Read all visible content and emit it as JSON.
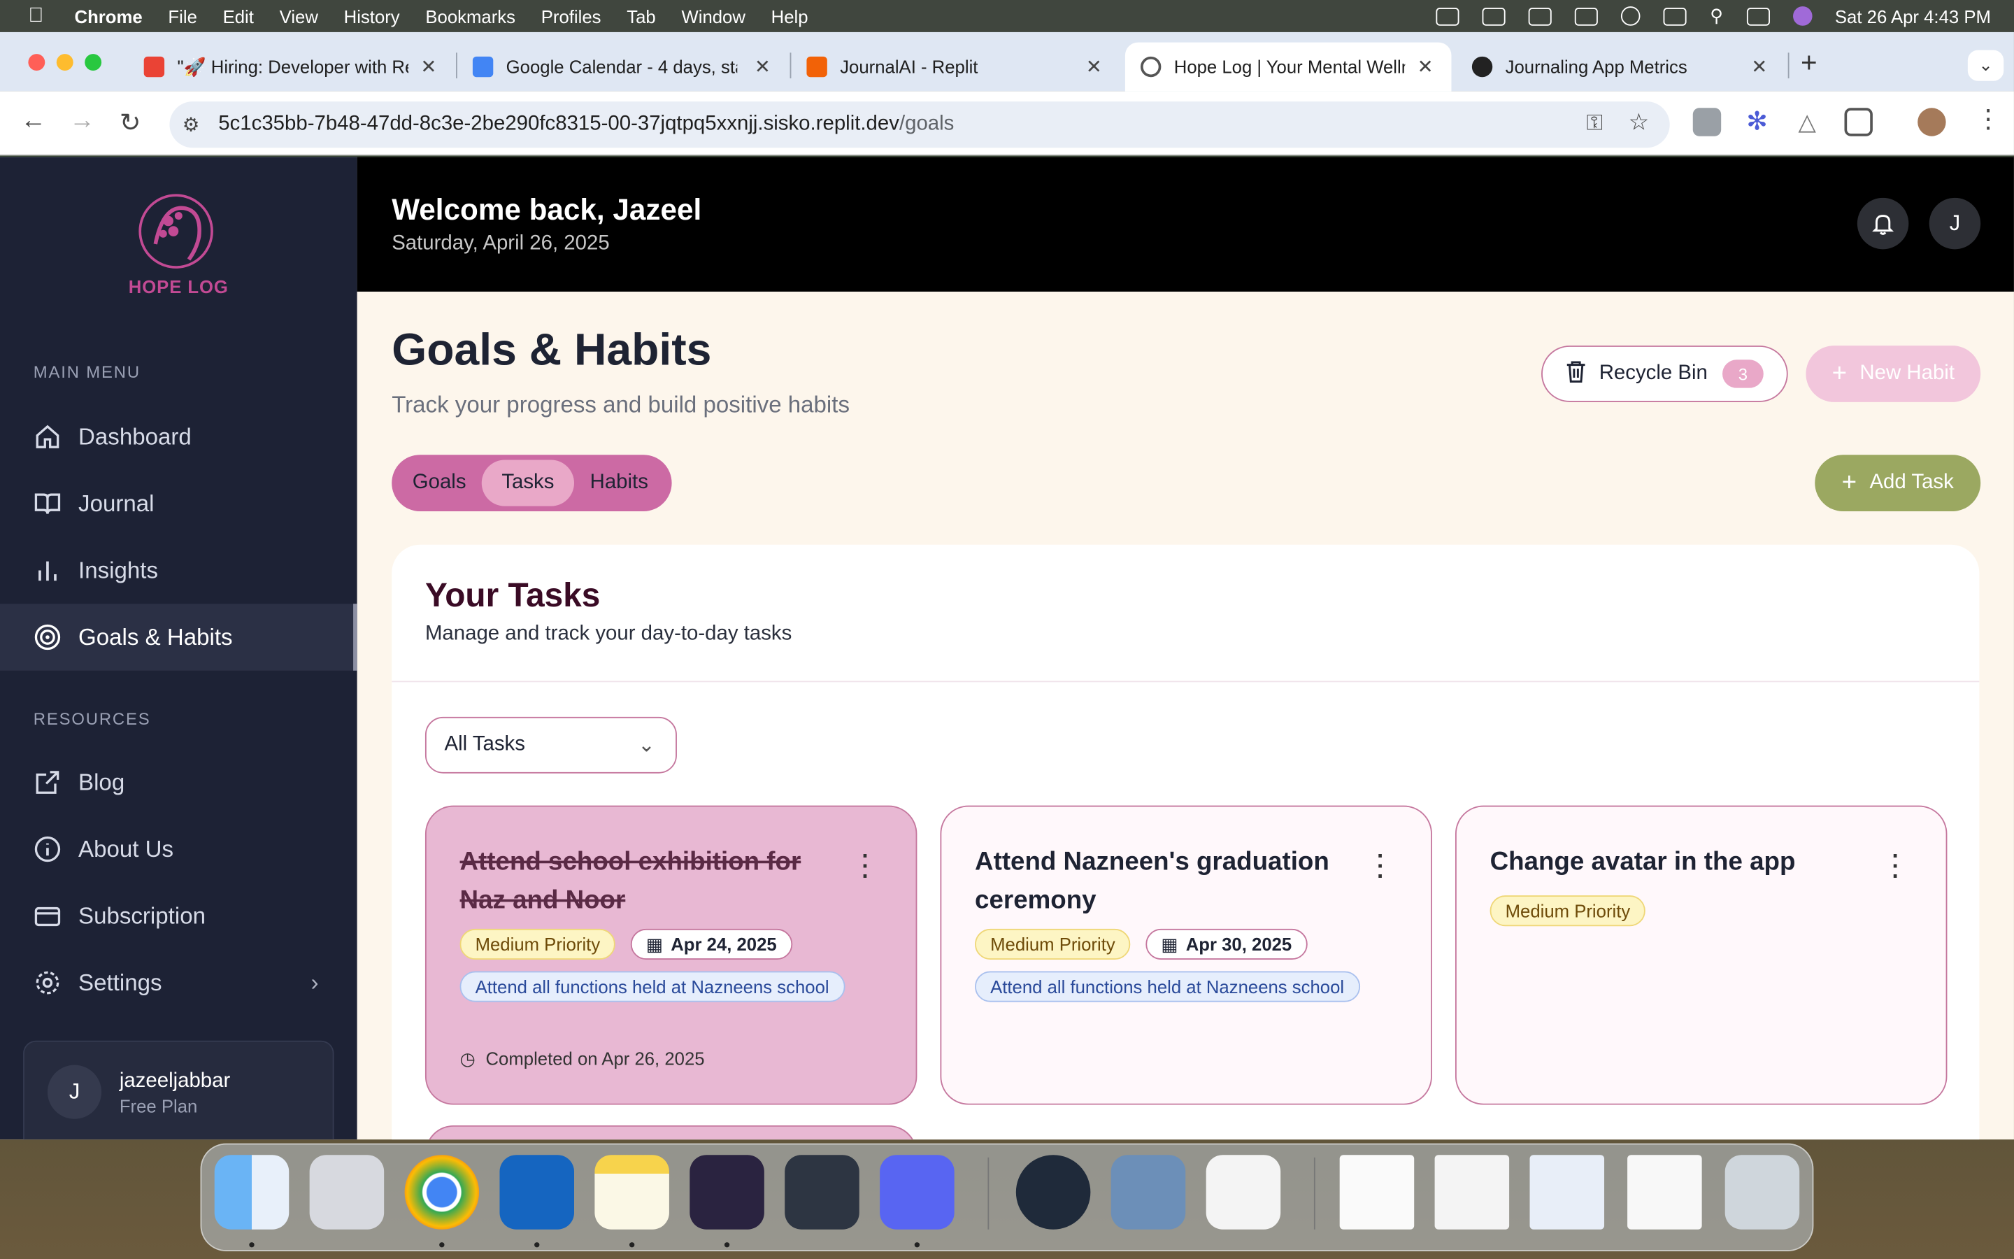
{
  "menubar": {
    "app": "Chrome",
    "items": [
      "File",
      "Edit",
      "View",
      "History",
      "Bookmarks",
      "Profiles",
      "Tab",
      "Window",
      "Help"
    ],
    "datetime": "Sat 26 Apr  4:43 PM"
  },
  "browser": {
    "tabs": [
      {
        "title": "\"🚀 Hiring: Developer with Re",
        "favicon": "gmail-icon",
        "color": "#ea4335"
      },
      {
        "title": "Google Calendar - 4 days, sta",
        "favicon": "calendar-icon",
        "color": "#4285f4"
      },
      {
        "title": "JournalAI - Replit",
        "favicon": "replit-icon",
        "color": "#f26207"
      },
      {
        "title": "Hope Log | Your Mental Welln",
        "favicon": "globe-icon",
        "color": "#555555"
      },
      {
        "title": "Journaling App Metrics",
        "favicon": "openai-icon",
        "color": "#222222"
      }
    ],
    "url_main": "5c1c35bb-7b48-47dd-8c3e-2be290fc8315-00-37jqtpq5xxnjj.sisko.replit.dev",
    "url_path": "/goals"
  },
  "sidebar": {
    "logo_text": "HOPE LOG",
    "main_menu_label": "MAIN MENU",
    "main_items": [
      {
        "label": "Dashboard",
        "icon": "home-icon"
      },
      {
        "label": "Journal",
        "icon": "book-icon"
      },
      {
        "label": "Insights",
        "icon": "chart-icon"
      },
      {
        "label": "Goals & Habits",
        "icon": "target-icon"
      }
    ],
    "resources_label": "RESOURCES",
    "resource_items": [
      {
        "label": "Blog",
        "icon": "external-link-icon"
      },
      {
        "label": "About Us",
        "icon": "info-icon"
      },
      {
        "label": "Subscription",
        "icon": "card-icon"
      },
      {
        "label": "Settings",
        "icon": "gear-icon"
      }
    ],
    "user": {
      "initial": "J",
      "name": "jazeeljabbar",
      "plan": "Free Plan"
    }
  },
  "header": {
    "welcome": "Welcome back, Jazeel",
    "date": "Saturday, April 26, 2025",
    "avatar": "J"
  },
  "page": {
    "title": "Goals & Habits",
    "subtitle": "Track your progress and build positive habits",
    "recycle_label": "Recycle Bin",
    "recycle_count": "3",
    "new_habit_label": "New Habit",
    "tabs": [
      "Goals",
      "Tasks",
      "Habits"
    ],
    "active_tab": "Tasks",
    "add_task_label": "Add Task"
  },
  "tasks_panel": {
    "title": "Your Tasks",
    "subtitle": "Manage and track your day-to-day tasks",
    "filter_value": "All Tasks",
    "cards": [
      {
        "title": "Attend school exhibition for Naz and Noor",
        "priority": "Medium Priority",
        "date": "Apr 24, 2025",
        "goal": "Attend all functions held at Nazneens school",
        "completed": "Completed on Apr 26, 2025"
      },
      {
        "title": "Attend Nazneen's graduation ceremony",
        "priority": "Medium Priority",
        "date": "Apr 30, 2025",
        "goal": "Attend all functions held at Nazneens school"
      },
      {
        "title": "Change avatar in the app",
        "priority": "Medium Priority"
      }
    ]
  },
  "colors": {
    "brand": "#c24a94",
    "sidebar": "#1d2235",
    "accent_green": "#9ba861",
    "page_bg": "#fdf6ec"
  }
}
